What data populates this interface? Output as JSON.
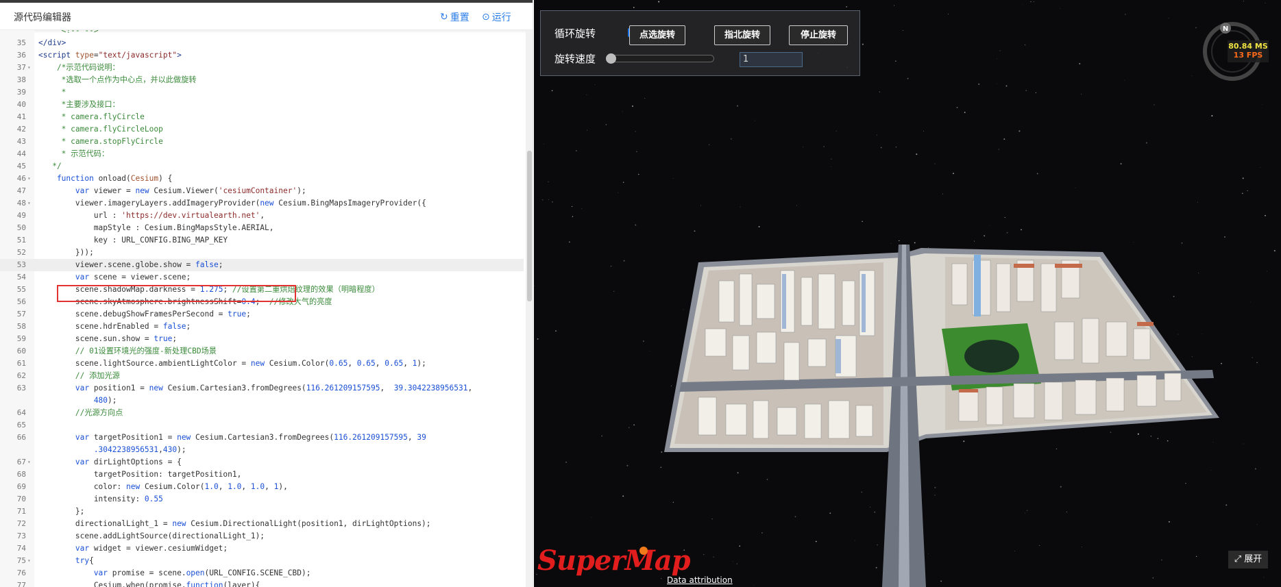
{
  "editor": {
    "title": "源代码编辑器",
    "reset_label": "重置",
    "run_label": "运行",
    "reset_icon": "refresh-icon",
    "run_icon": "play-icon",
    "lines": [
      {
        "n": "",
        "fold": "",
        "tokens": [
          [
            "com",
            "     <!-- -->"
          ]
        ]
      },
      {
        "n": "35",
        "fold": "",
        "tokens": [
          [
            "tag",
            "</div>"
          ]
        ]
      },
      {
        "n": "36",
        "fold": "",
        "tokens": [
          [
            "tag",
            "<script "
          ],
          [
            "attr",
            "type"
          ],
          [
            "",
            "="
          ],
          [
            "str",
            "\"text/javascript\""
          ],
          [
            "tag",
            ">"
          ]
        ]
      },
      {
        "n": "37",
        "fold": "▾",
        "tokens": [
          [
            "com",
            "    /*示范代码说明："
          ]
        ]
      },
      {
        "n": "38",
        "fold": "",
        "tokens": [
          [
            "com",
            "     *选取一个点作为中心点，并以此做旋转"
          ]
        ]
      },
      {
        "n": "39",
        "fold": "",
        "tokens": [
          [
            "com",
            "     *"
          ]
        ]
      },
      {
        "n": "40",
        "fold": "",
        "tokens": [
          [
            "com",
            "     *主要涉及接口："
          ]
        ]
      },
      {
        "n": "41",
        "fold": "",
        "tokens": [
          [
            "com",
            "     * camera.flyCircle"
          ]
        ]
      },
      {
        "n": "42",
        "fold": "",
        "tokens": [
          [
            "com",
            "     * camera.flyCircleLoop"
          ]
        ]
      },
      {
        "n": "43",
        "fold": "",
        "tokens": [
          [
            "com",
            "     * camera.stopFlyCircle"
          ]
        ]
      },
      {
        "n": "44",
        "fold": "",
        "tokens": [
          [
            "com",
            "     * 示范代码："
          ]
        ]
      },
      {
        "n": "45",
        "fold": "",
        "tokens": [
          [
            "com",
            "   */"
          ]
        ]
      },
      {
        "n": "46",
        "fold": "▾",
        "tokens": [
          [
            "kw",
            "    function "
          ],
          [
            "",
            "onload("
          ],
          [
            "attr",
            "Cesium"
          ],
          [
            "",
            ") {"
          ]
        ]
      },
      {
        "n": "47",
        "fold": "",
        "tokens": [
          [
            "kw",
            "        var "
          ],
          [
            "",
            "viewer = "
          ],
          [
            "kw",
            "new "
          ],
          [
            "",
            "Cesium.Viewer("
          ],
          [
            "str",
            "'cesiumContainer'"
          ],
          [
            "",
            ");"
          ]
        ]
      },
      {
        "n": "48",
        "fold": "▾",
        "tokens": [
          [
            "",
            "        viewer.imageryLayers.addImageryProvider("
          ],
          [
            "kw",
            "new "
          ],
          [
            "",
            "Cesium.BingMapsImageryProvider({"
          ]
        ]
      },
      {
        "n": "49",
        "fold": "",
        "tokens": [
          [
            "",
            "            url : "
          ],
          [
            "str",
            "'https://dev.virtualearth.net'"
          ],
          [
            "",
            ","
          ]
        ]
      },
      {
        "n": "50",
        "fold": "",
        "tokens": [
          [
            "",
            "            mapStyle : Cesium.BingMapsStyle.AERIAL,"
          ]
        ]
      },
      {
        "n": "51",
        "fold": "",
        "tokens": [
          [
            "",
            "            key : URL_CONFIG.BING_MAP_KEY"
          ]
        ]
      },
      {
        "n": "52",
        "fold": "",
        "tokens": [
          [
            "",
            "        }));"
          ]
        ]
      },
      {
        "n": "53",
        "fold": "",
        "hl": true,
        "tokens": [
          [
            "",
            "        viewer.scene.globe.show = "
          ],
          [
            "bool",
            "false"
          ],
          [
            "",
            ";"
          ]
        ]
      },
      {
        "n": "54",
        "fold": "",
        "tokens": [
          [
            "kw",
            "        var "
          ],
          [
            "",
            "scene = viewer.scene;"
          ]
        ]
      },
      {
        "n": "55",
        "fold": "",
        "tokens": [
          [
            "",
            "        scene.shadowMap.darkness = "
          ],
          [
            "num",
            "1.275"
          ],
          [
            "",
            "; "
          ],
          [
            "com",
            "//设置第二重烘焙纹理的效果（明暗程度）"
          ]
        ]
      },
      {
        "n": "56",
        "fold": "",
        "tokens": [
          [
            "",
            "        scene.skyAtmosphere.brightnessShift="
          ],
          [
            "num",
            "0.4"
          ],
          [
            "",
            ";  "
          ],
          [
            "com",
            "//修改大气的亮度"
          ]
        ]
      },
      {
        "n": "57",
        "fold": "",
        "tokens": [
          [
            "",
            "        scene.debugShowFramesPerSecond = "
          ],
          [
            "bool",
            "true"
          ],
          [
            "",
            ";"
          ]
        ]
      },
      {
        "n": "58",
        "fold": "",
        "tokens": [
          [
            "",
            "        scene.hdrEnabled = "
          ],
          [
            "bool",
            "false"
          ],
          [
            "",
            ";"
          ]
        ]
      },
      {
        "n": "59",
        "fold": "",
        "tokens": [
          [
            "",
            "        scene.sun.show = "
          ],
          [
            "bool",
            "true"
          ],
          [
            "",
            ";"
          ]
        ]
      },
      {
        "n": "60",
        "fold": "",
        "tokens": [
          [
            "com",
            "        // 01设置环境光的强度-新处理CBD场景"
          ]
        ]
      },
      {
        "n": "61",
        "fold": "",
        "tokens": [
          [
            "",
            "        scene.lightSource.ambientLightColor = "
          ],
          [
            "kw",
            "new "
          ],
          [
            "",
            "Cesium.Color("
          ],
          [
            "num",
            "0.65"
          ],
          [
            "",
            ", "
          ],
          [
            "num",
            "0.65"
          ],
          [
            "",
            ", "
          ],
          [
            "num",
            "0.65"
          ],
          [
            "",
            ", "
          ],
          [
            "num",
            "1"
          ],
          [
            "",
            ");"
          ]
        ]
      },
      {
        "n": "62",
        "fold": "",
        "tokens": [
          [
            "com",
            "        // 添加光源"
          ]
        ]
      },
      {
        "n": "63",
        "fold": "",
        "tokens": [
          [
            "kw",
            "        var "
          ],
          [
            "",
            "position1 = "
          ],
          [
            "kw",
            "new "
          ],
          [
            "",
            "Cesium.Cartesian3.fromDegrees("
          ],
          [
            "num",
            "116.261209157595"
          ],
          [
            "",
            ",  "
          ],
          [
            "num",
            "39.3042238956531"
          ],
          [
            "",
            ","
          ]
        ]
      },
      {
        "n": "",
        "fold": "",
        "tokens": [
          [
            "num",
            "            480"
          ],
          [
            "",
            ");"
          ]
        ]
      },
      {
        "n": "64",
        "fold": "",
        "tokens": [
          [
            "com",
            "        //光源方向点"
          ]
        ]
      },
      {
        "n": "65",
        "fold": "",
        "tokens": [
          [
            "",
            ""
          ]
        ]
      },
      {
        "n": "66",
        "fold": "",
        "tokens": [
          [
            "kw",
            "        var "
          ],
          [
            "",
            "targetPosition1 = "
          ],
          [
            "kw",
            "new "
          ],
          [
            "",
            "Cesium.Cartesian3.fromDegrees("
          ],
          [
            "num",
            "116.261209157595"
          ],
          [
            "",
            ", "
          ],
          [
            "num",
            "39"
          ]
        ]
      },
      {
        "n": "",
        "fold": "",
        "tokens": [
          [
            "num",
            "            .3042238956531"
          ],
          [
            "",
            ","
          ],
          [
            "num",
            "430"
          ],
          [
            "",
            ");"
          ]
        ]
      },
      {
        "n": "67",
        "fold": "▾",
        "tokens": [
          [
            "kw",
            "        var "
          ],
          [
            "",
            "dirLightOptions = {"
          ]
        ]
      },
      {
        "n": "68",
        "fold": "",
        "tokens": [
          [
            "",
            "            targetPosition: targetPosition1,"
          ]
        ]
      },
      {
        "n": "69",
        "fold": "",
        "tokens": [
          [
            "",
            "            color: "
          ],
          [
            "kw",
            "new "
          ],
          [
            "",
            "Cesium.Color("
          ],
          [
            "num",
            "1.0"
          ],
          [
            "",
            ", "
          ],
          [
            "num",
            "1.0"
          ],
          [
            "",
            ", "
          ],
          [
            "num",
            "1.0"
          ],
          [
            "",
            ", "
          ],
          [
            "num",
            "1"
          ],
          [
            "",
            "),"
          ]
        ]
      },
      {
        "n": "70",
        "fold": "",
        "tokens": [
          [
            "",
            "            intensity: "
          ],
          [
            "num",
            "0.55"
          ]
        ]
      },
      {
        "n": "71",
        "fold": "",
        "tokens": [
          [
            "",
            "        };"
          ]
        ]
      },
      {
        "n": "72",
        "fold": "",
        "tokens": [
          [
            "",
            "        directionalLight_1 = "
          ],
          [
            "kw",
            "new "
          ],
          [
            "",
            "Cesium.DirectionalLight(position1, dirLightOptions);"
          ]
        ]
      },
      {
        "n": "73",
        "fold": "",
        "tokens": [
          [
            "",
            "        scene.addLightSource(directionalLight_1);"
          ]
        ]
      },
      {
        "n": "74",
        "fold": "",
        "tokens": [
          [
            "kw",
            "        var "
          ],
          [
            "",
            "widget = viewer.cesiumWidget;"
          ]
        ]
      },
      {
        "n": "75",
        "fold": "▾",
        "tokens": [
          [
            "kw",
            "        try"
          ],
          [
            "",
            "{"
          ]
        ]
      },
      {
        "n": "76",
        "fold": "",
        "tokens": [
          [
            "kw",
            "            var "
          ],
          [
            "",
            "promise = scene."
          ],
          [
            "kw",
            "open"
          ],
          [
            "",
            "(URL_CONFIG.SCENE_CBD);"
          ]
        ]
      },
      {
        "n": "77",
        "fold": "",
        "tokens": [
          [
            "",
            "            Cesium.when(promise,"
          ],
          [
            "kw",
            "function"
          ],
          [
            "",
            "(layer){"
          ]
        ]
      }
    ]
  },
  "viewer": {
    "loop_label": "循环旋转",
    "loop_checked": true,
    "pick_label": "点选旋转",
    "north_label": "指北旋转",
    "stop_label": "停止旋转",
    "speed_label": "旋转速度",
    "speed_value": "1",
    "compass_letter": "N",
    "fps_ms": "80.84 MS",
    "fps_fps": "13 FPS",
    "logo_text": "SuperMap",
    "attribution": "Data attribution",
    "expand_label": "展开",
    "expand_icon": "expand-icon"
  },
  "colors": {
    "accent": "#2b7de9",
    "highlight_border": "#e23232",
    "logo_red": "#e11d1d",
    "fps_ms": "#f0e442",
    "fps_fps": "#ff6a1a"
  }
}
